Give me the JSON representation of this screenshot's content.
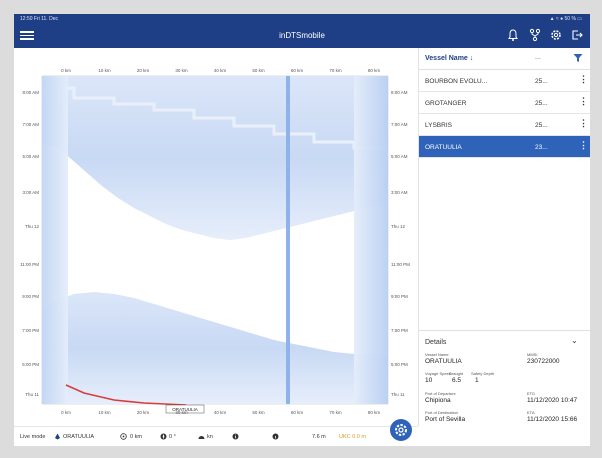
{
  "status_bar": {
    "time": "12:50  Fri 11. Dec",
    "right": "▲ ≈ ● 50 % ▭"
  },
  "app": {
    "title": "inDTSmobile"
  },
  "chart": {
    "top_ticks": [
      "0 km",
      "10 km",
      "20 km",
      "30 km",
      "40 km",
      "50 km",
      "60 km",
      "70 km",
      "80 km"
    ],
    "bottom_ticks": [
      "0 km",
      "10 km",
      "20 km",
      "30 km",
      "40 km",
      "50 km",
      "60 km",
      "70 km",
      "80 km"
    ],
    "left_ticks": [
      "8:00 AM",
      "7:00 AM",
      "5:00 AM",
      "3:00 AM",
      "Thu 12",
      "11:00 PM",
      "9:00 PM",
      "7:00 PM",
      "5:00 PM",
      "Thu 11"
    ],
    "right_ticks": [
      "8:00 AM",
      "7:00 AM",
      "5:00 AM",
      "3:00 AM",
      "Thu 12",
      "11:00 PM",
      "9:00 PM",
      "7:00 PM",
      "5:00 PM",
      "Thu 11"
    ],
    "vessel_label": "ORATUULIA"
  },
  "vessel_list": {
    "header": {
      "name": "Vessel Name ↓",
      "col": "..."
    },
    "rows": [
      {
        "name": "BOURBON EVOLU...",
        "value": "25..."
      },
      {
        "name": "GROTANGER",
        "value": "25..."
      },
      {
        "name": "LYSBRIS",
        "value": "25..."
      },
      {
        "name": "ORATUULIA",
        "value": "23..."
      }
    ]
  },
  "details": {
    "title": "Details",
    "vessel_name_label": "Vessel Name",
    "vessel_name": "ORATUULIA",
    "mmsi_label": "MMSI",
    "mmsi": "230722000",
    "voyage_speed_label": "Voyage Speed",
    "voyage_speed": "10",
    "draught_label": "Draught",
    "draught": "6.5",
    "safety_depth_label": "Safety Depth",
    "safety_depth": "1",
    "departure_label": "Port of Departure",
    "departure": "Chipiona",
    "etd_label": "ETD",
    "etd": "11/12/2020 10:47",
    "destination_label": "Port of Destination",
    "destination": "Port of Sevilla",
    "eta_label": "ETA",
    "eta": "11/12/2020 15:66"
  },
  "bottom_bar": {
    "live_mode": "Live mode",
    "vessel": "ORATUULIA",
    "km": "0 km",
    "deg": "0 °",
    "kn": "kn",
    "depth": "7.6 m",
    "utc": "UKC 0.0 m"
  },
  "colors": {
    "header": "#1e3f86",
    "selected": "#2f63b9",
    "band": "#a9c4ef",
    "track": "#d83c3c"
  }
}
